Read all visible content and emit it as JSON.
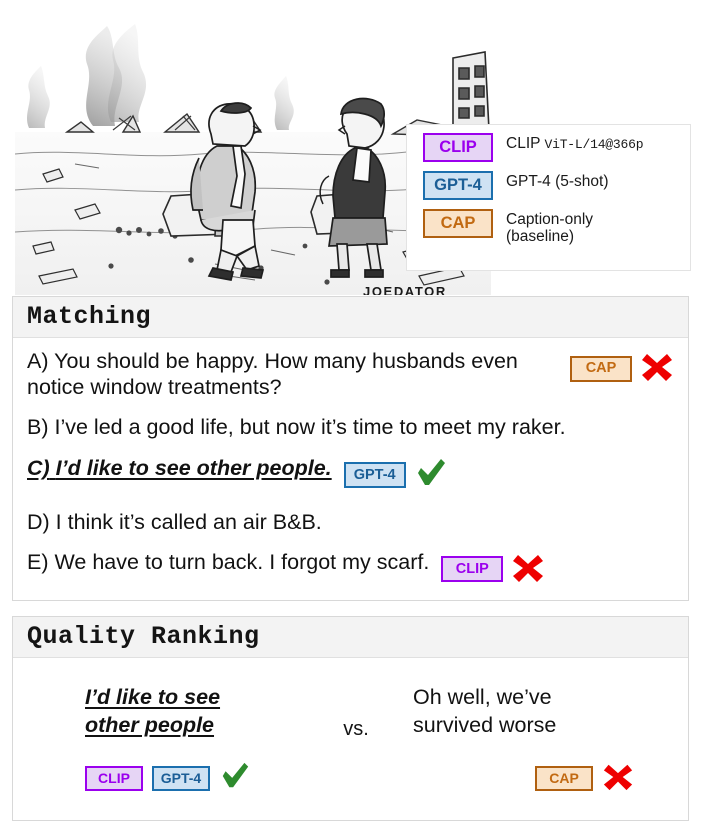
{
  "figure": {
    "cartoon": {
      "alt": "New Yorker style cartoon: a man and a woman in business attire sit on concrete rubble in a devastated landscape with smoke plumes and a ruined building",
      "signature": "JOEDATOR"
    },
    "legend": {
      "items": [
        {
          "badge": "CLIP",
          "badge_style": "clip",
          "desc_main": "CLIP",
          "desc_mono": "ViT-L/14@366p",
          "color": "#9b00ee"
        },
        {
          "badge": "GPT-4",
          "badge_style": "gpt4",
          "desc_main": "GPT-4 (5-shot)",
          "desc_mono": "",
          "color": "#1b6fae"
        },
        {
          "badge": "CAP",
          "badge_style": "cap",
          "desc_main": "Caption-only\n(baseline)",
          "desc_mono": "",
          "color": "#b06010"
        }
      ]
    },
    "sections": [
      {
        "id": "matching",
        "title": "Matching",
        "options": [
          {
            "label": "A)",
            "text": "You should be happy. How many husbands even notice window treatments?",
            "correct": false,
            "badges": [
              "CAP"
            ],
            "mark": "cross"
          },
          {
            "label": "B)",
            "text": "I’ve led a good life, but now it’s time to meet my raker.",
            "correct": false,
            "badges": [],
            "mark": ""
          },
          {
            "label": "C)",
            "text": "I’d like to see other people.",
            "correct": true,
            "badges": [
              "GPT-4"
            ],
            "mark": "check"
          },
          {
            "label": "D)",
            "text": "I think it’s called an air B&B.",
            "correct": false,
            "badges": [],
            "mark": ""
          },
          {
            "label": "E)",
            "text": "We have to turn back. I forgot my scarf.",
            "correct": false,
            "badges": [
              "CLIP"
            ],
            "mark": "cross"
          }
        ]
      },
      {
        "id": "quality",
        "title": "Quality Ranking",
        "vs_label": "vs.",
        "left": {
          "caption": "I’d like to see\nother people",
          "correct": true,
          "badges": [
            "CLIP",
            "GPT-4"
          ],
          "mark": "check"
        },
        "right": {
          "caption": "Oh well, we’ve\nsurvived worse",
          "correct": false,
          "badges": [
            "CAP"
          ],
          "mark": "cross"
        }
      }
    ],
    "colors": {
      "clip": "#9b00ee",
      "gpt4": "#1b6fae",
      "cap": "#b06010",
      "check": "#2e8b2e",
      "cross": "#ee0000",
      "panel_header_bg": "#f3f3f3",
      "panel_border": "#d8d8d8"
    }
  }
}
